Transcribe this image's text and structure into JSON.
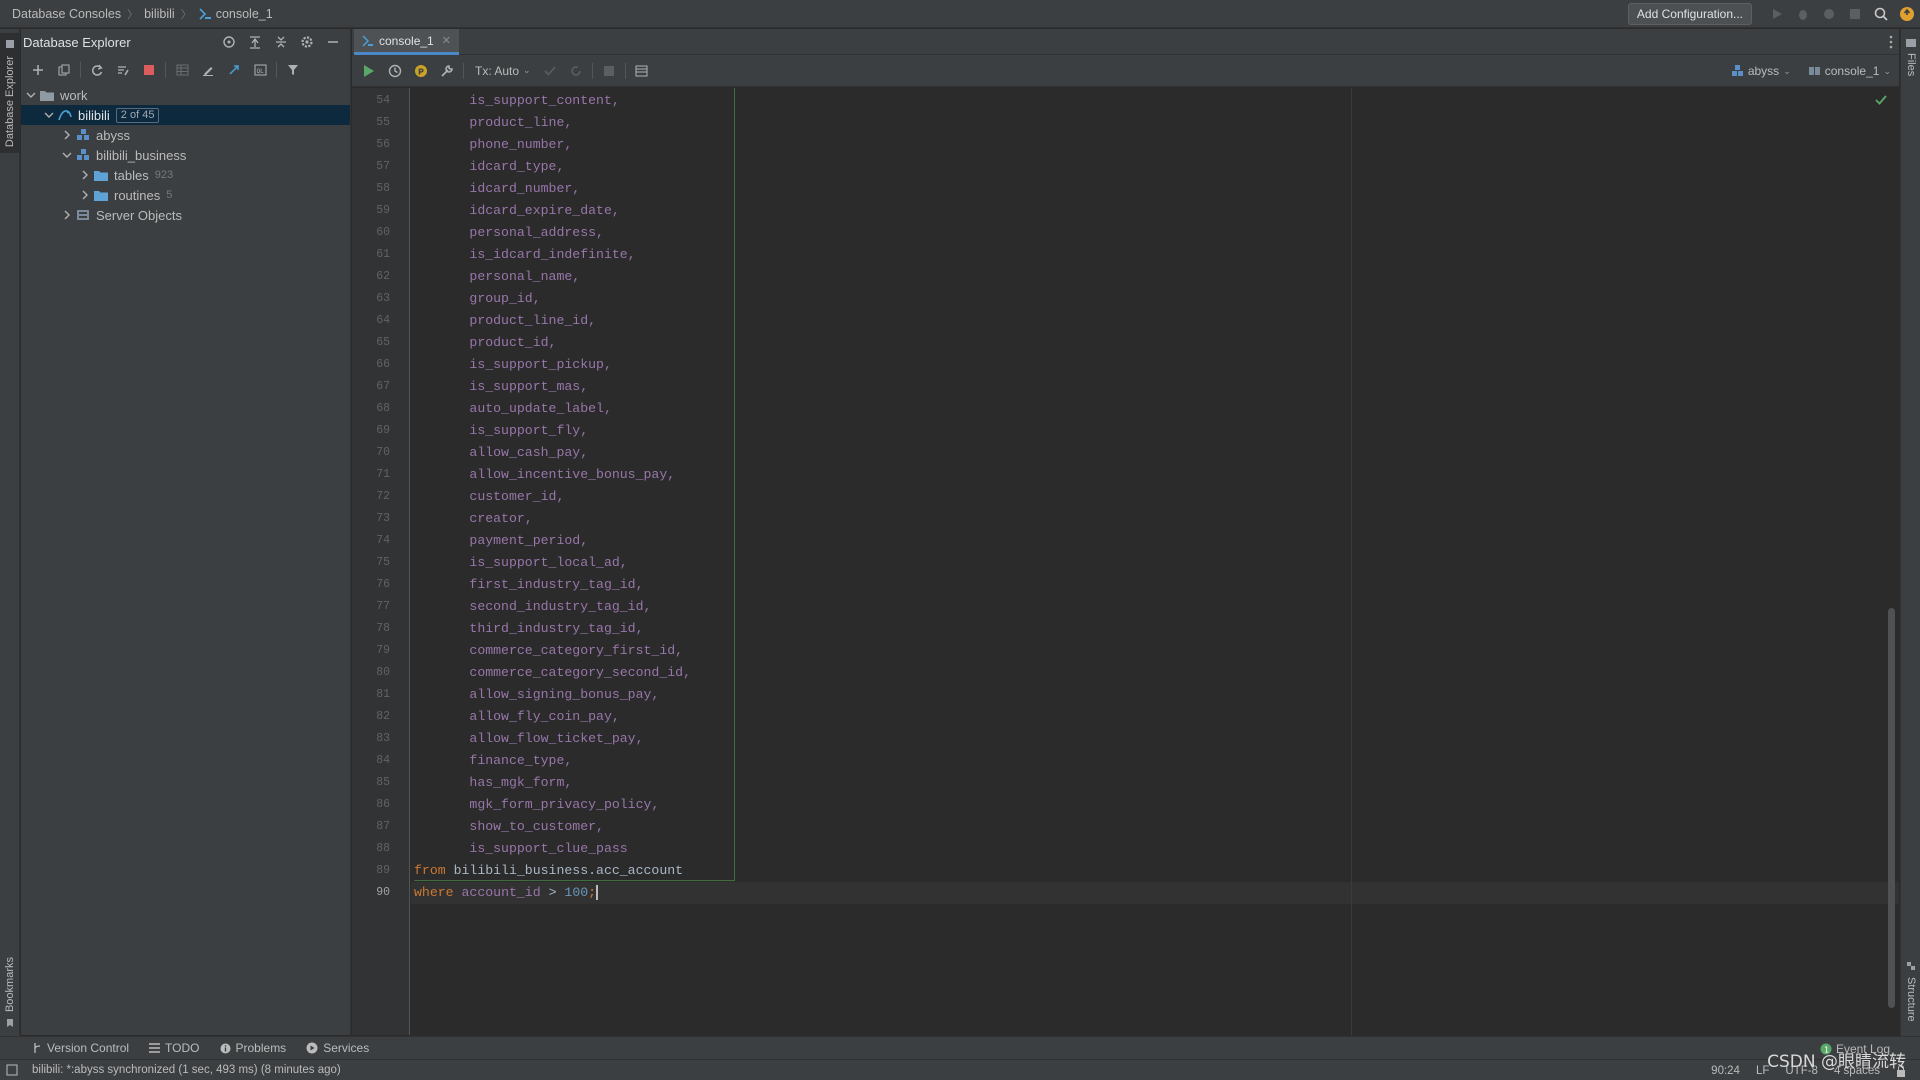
{
  "breadcrumb": {
    "root": "Database Consoles",
    "db": "bilibili",
    "console": "console_1"
  },
  "navbar": {
    "add_config": "Add Configuration..."
  },
  "left_strip": {
    "database_explorer": "Database Explorer",
    "bookmarks": "Bookmarks"
  },
  "right_strip": {
    "files": "Files",
    "structure": "Structure"
  },
  "panel": {
    "title": "Database Explorer"
  },
  "tree": {
    "work": "work",
    "bilibili": "bilibili",
    "bilibili_badge": "2 of 45",
    "abyss": "abyss",
    "bilibili_business": "bilibili_business",
    "tables": "tables",
    "tables_count": "923",
    "routines": "routines",
    "routines_count": "5",
    "server_objects": "Server Objects"
  },
  "editor": {
    "tab_label": "console_1",
    "tx_label": "Tx: Auto",
    "schema_dropdown": "abyss",
    "session_dropdown": "console_1"
  },
  "code": {
    "columns": [
      "is_support_content,",
      "product_line,",
      "phone_number,",
      "idcard_type,",
      "idcard_number,",
      "idcard_expire_date,",
      "personal_address,",
      "is_idcard_indefinite,",
      "personal_name,",
      "group_id,",
      "product_line_id,",
      "product_id,",
      "is_support_pickup,",
      "is_support_mas,",
      "auto_update_label,",
      "is_support_fly,",
      "allow_cash_pay,",
      "allow_incentive_bonus_pay,",
      "customer_id,",
      "creator,",
      "payment_period,",
      "is_support_local_ad,",
      "first_industry_tag_id,",
      "second_industry_tag_id,",
      "third_industry_tag_id,",
      "commerce_category_first_id,",
      "commerce_category_second_id,",
      "allow_signing_bonus_pay,",
      "allow_fly_coin_pay,",
      "allow_flow_ticket_pay,",
      "finance_type,",
      "has_mgk_form,",
      "mgk_form_privacy_policy,",
      "show_to_customer,",
      "is_support_clue_pass"
    ],
    "first_line_number": 54,
    "from_kw": "from",
    "from_table": "bilibili_business.acc_account",
    "where_kw": "where",
    "where_col": "account_id",
    "where_op": ">",
    "where_val": "100",
    "semicolon": ";"
  },
  "line_numbers": [
    "54",
    "55",
    "56",
    "57",
    "58",
    "59",
    "60",
    "61",
    "62",
    "63",
    "64",
    "65",
    "66",
    "67",
    "68",
    "69",
    "70",
    "71",
    "72",
    "73",
    "74",
    "75",
    "76",
    "77",
    "78",
    "79",
    "80",
    "81",
    "82",
    "83",
    "84",
    "85",
    "86",
    "87",
    "88",
    "89",
    "90"
  ],
  "bottom_tabs": {
    "version_control": "Version Control",
    "todo": "TODO",
    "problems": "Problems",
    "services": "Services",
    "event_log": "Event Log"
  },
  "status": {
    "message": "bilibili: *:abyss synchronized (1 sec, 493 ms) (8 minutes ago)",
    "position": "90:24",
    "line_sep": "LF",
    "encoding": "UTF-8",
    "indent": "4 spaces"
  },
  "watermark": "CSDN @眼睛流转",
  "colors": {
    "accent": "#4a88c7",
    "keyword": "#cc7832",
    "identifier": "#9876aa",
    "number": "#6897bb",
    "run_green": "#59a869",
    "stop_red": "#db5c5c"
  }
}
